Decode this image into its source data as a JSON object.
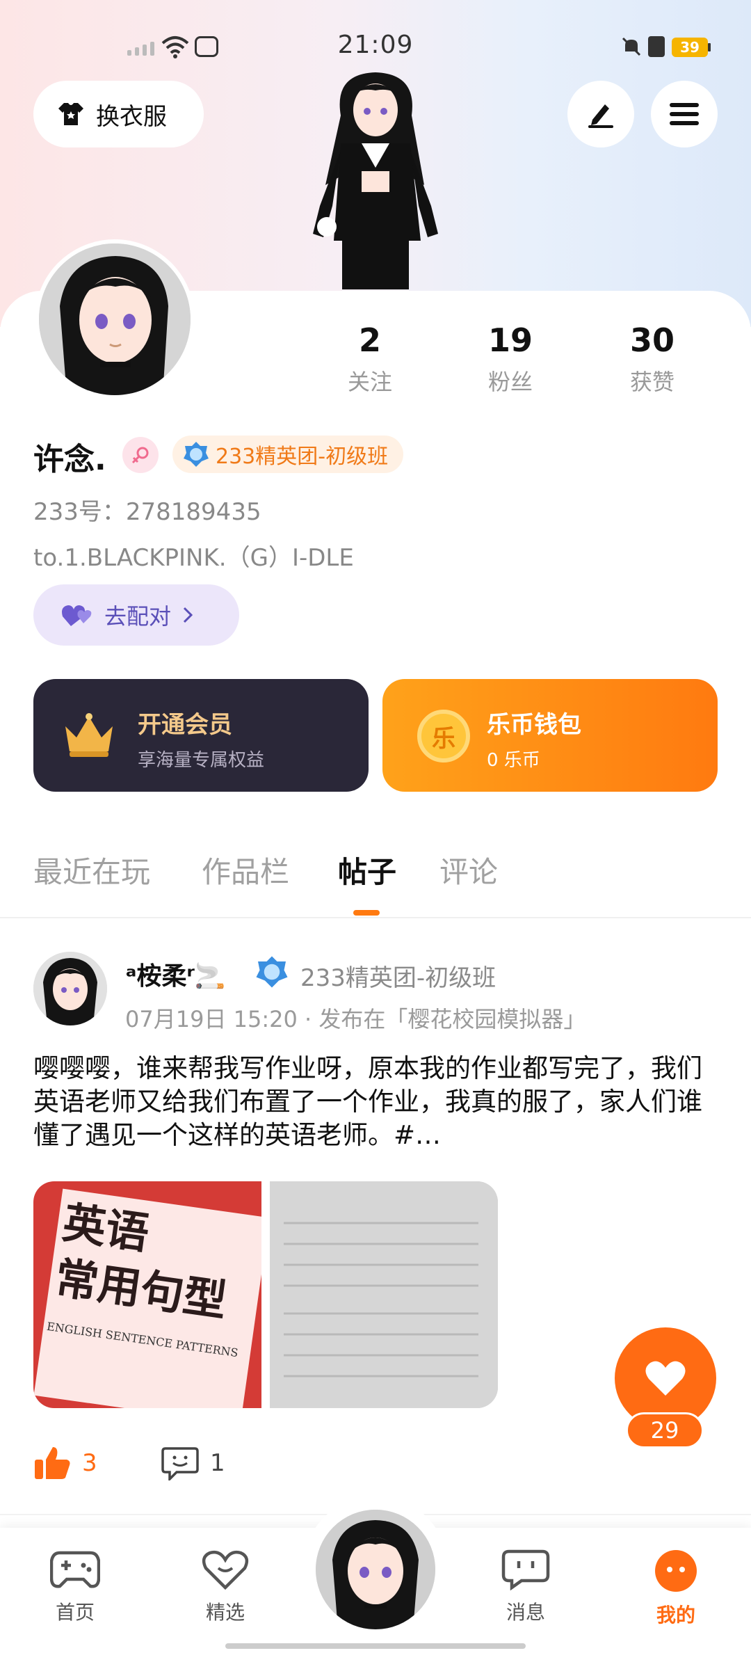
{
  "status_bar": {
    "time": "21:09",
    "battery": "39"
  },
  "header": {
    "outfit_label": "换衣服"
  },
  "profile": {
    "stats": [
      {
        "value": "2",
        "label": "关注"
      },
      {
        "value": "19",
        "label": "粉丝"
      },
      {
        "value": "30",
        "label": "获赞"
      }
    ],
    "username": "许念.",
    "badge": "233精英团-初级班",
    "uid": "233号：278189435",
    "bio": "to.1.BLACKPINK.（G）I-DLE",
    "match_label": "去配对"
  },
  "cards": {
    "vip": {
      "title": "开通会员",
      "subtitle": "享海量专属权益"
    },
    "wallet": {
      "title": "乐币钱包",
      "subtitle": "0 乐币",
      "coin_glyph": "乐"
    }
  },
  "tabs": [
    {
      "label": "最近在玩",
      "active": false
    },
    {
      "label": "作品栏",
      "active": false
    },
    {
      "label": "帖子",
      "active": true
    },
    {
      "label": "评论",
      "active": false
    }
  ],
  "post": {
    "author": "ᵃ桉柔ʳ🚬",
    "badge": "233精英团-初级班",
    "meta": "07月19日 15:20 · 发布在「樱花校园模拟器」",
    "text": "嘤嘤嘤，谁来帮我写作业呀，原本我的作业都写完了，我们英语老师又给我们布置了一个作业，我真的服了，家人们谁懂了遇见一个这样的英语老师。#…",
    "image1_title_line1": "英语",
    "image1_title_line2": "常用句型",
    "image1_subtitle": "ENGLISH SENTENCE PATTERNS",
    "likes": "3",
    "comments": "1"
  },
  "like_fab": {
    "count": "29"
  },
  "bottom_nav": [
    {
      "label": "首页",
      "active": false
    },
    {
      "label": "精选",
      "active": false
    },
    {
      "label": "消息",
      "active": false
    },
    {
      "label": "我的",
      "active": true
    }
  ],
  "colors": {
    "accent": "#ff6b13",
    "badge_text": "#f07a18",
    "match": "#5a4fb8",
    "vip_bg": "#2a2738"
  }
}
